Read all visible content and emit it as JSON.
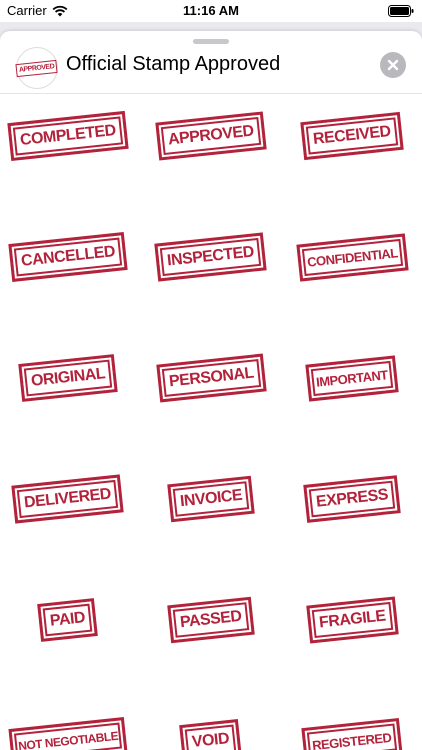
{
  "status_bar": {
    "carrier": "Carrier",
    "time": "11:16 AM"
  },
  "header": {
    "title": "Official Stamp Approved",
    "icon_text": "APPROVED"
  },
  "stickers": [
    "COMPLETED",
    "APPROVED",
    "RECEIVED",
    "CANCELLED",
    "INSPECTED",
    "CONFIDENTIAL",
    "ORIGINAL",
    "PERSONAL",
    "IMPORTANT",
    "DELIVERED",
    "INVOICE",
    "EXPRESS",
    "PAID",
    "PASSED",
    "FRAGILE",
    "NOT NEGOTIABLE",
    "VOID",
    "REGISTERED"
  ],
  "colors": {
    "stamp_red": "#b3223b",
    "close_button": "#b8b8bd"
  }
}
